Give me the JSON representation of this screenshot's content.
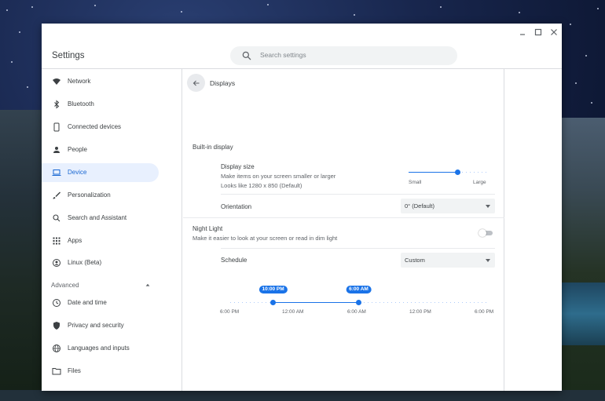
{
  "window": {
    "title": "Settings",
    "search_placeholder": "Search settings"
  },
  "sidebar": {
    "items": [
      {
        "label": "Network",
        "icon": "wifi-icon"
      },
      {
        "label": "Bluetooth",
        "icon": "bluetooth-icon"
      },
      {
        "label": "Connected devices",
        "icon": "phone-icon"
      },
      {
        "label": "People",
        "icon": "person-icon"
      },
      {
        "label": "Device",
        "icon": "laptop-icon",
        "active": true
      },
      {
        "label": "Personalization",
        "icon": "brush-icon"
      },
      {
        "label": "Search and Assistant",
        "icon": "search-icon"
      },
      {
        "label": "Apps",
        "icon": "apps-grid-icon"
      },
      {
        "label": "Linux (Beta)",
        "icon": "linux-icon"
      }
    ],
    "advanced_label": "Advanced",
    "advanced_items": [
      {
        "label": "Date and time",
        "icon": "clock-icon"
      },
      {
        "label": "Privacy and security",
        "icon": "shield-icon"
      },
      {
        "label": "Languages and inputs",
        "icon": "globe-icon"
      },
      {
        "label": "Files",
        "icon": "folder-icon"
      }
    ]
  },
  "main": {
    "page_title": "Displays",
    "section_title": "Built-in display",
    "display_size": {
      "title": "Display size",
      "description": "Make items on your screen smaller or larger",
      "detail": "Looks like 1280 x 850 (Default)",
      "min_label": "Small",
      "max_label": "Large",
      "level": 0.62
    },
    "orientation": {
      "label": "Orientation",
      "value": "0° (Default)"
    },
    "night_light": {
      "title": "Night Light",
      "description": "Make it easier to look at your screen or read in dim light",
      "enabled": false
    },
    "schedule": {
      "label": "Schedule",
      "value": "Custom",
      "start_badge": "10:00 PM",
      "end_badge": "6:00 AM",
      "start_level": 0.167,
      "end_level": 0.5,
      "ticks": [
        "6:00 PM",
        "12:00 AM",
        "6:00 AM",
        "12:00 PM",
        "6:00 PM"
      ]
    }
  },
  "colors": {
    "accent": "#1a73e8",
    "active_bg": "#e8f0fe",
    "text": "#3c4043",
    "secondary_text": "#5f6368"
  }
}
